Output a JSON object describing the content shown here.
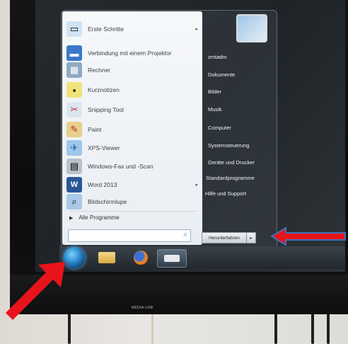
{
  "start_menu": {
    "left_items": [
      {
        "label": "Erste Schritte",
        "icon": "getting-started-icon",
        "has_submenu": true
      },
      {
        "label": "Verbindung mit einem Projektor",
        "icon": "projector-icon",
        "has_submenu": false
      },
      {
        "label": "Rechner",
        "icon": "calculator-icon",
        "has_submenu": false
      },
      {
        "label": "Kurznotizen",
        "icon": "sticky-notes-icon",
        "has_submenu": false
      },
      {
        "label": "Snipping Tool",
        "icon": "scissors-icon",
        "has_submenu": false
      },
      {
        "label": "Paint",
        "icon": "paint-icon",
        "has_submenu": false
      },
      {
        "label": "XPS-Viewer",
        "icon": "xps-viewer-icon",
        "has_submenu": false
      },
      {
        "label": "Windows-Fax und -Scan",
        "icon": "fax-scan-icon",
        "has_submenu": false
      },
      {
        "label": "Word 2013",
        "icon": "word-icon",
        "has_submenu": true
      },
      {
        "label": "Bildschirmlupe",
        "icon": "magnifier-icon",
        "has_submenu": false
      }
    ],
    "all_programs_label": "Alle Programme",
    "search_placeholder": "",
    "right_items": [
      {
        "label": "zmtadm"
      },
      {
        "label": "Dokumente"
      },
      {
        "label": "Bilder"
      },
      {
        "label": "Musik"
      },
      {
        "label": "Computer"
      },
      {
        "label": "Systemsteuerung"
      },
      {
        "label": "Geräte und Drucker"
      },
      {
        "label": "Standardprogramme"
      },
      {
        "label": "Hilfe und Support"
      }
    ],
    "shutdown_label": "Herunterfahren",
    "shutdown_arrow": "▸"
  },
  "taskbar": {
    "items": [
      {
        "icon": "windows-start-orb-icon"
      },
      {
        "icon": "file-explorer-folder-icon"
      },
      {
        "icon": "firefox-icon"
      },
      {
        "icon": "app-icon"
      }
    ]
  },
  "monitor": {
    "bezel_label": "MEDIA-USB"
  },
  "annotations": {
    "arrow_color": "#e8141a",
    "arrow_outline": "#3f6fb8"
  }
}
